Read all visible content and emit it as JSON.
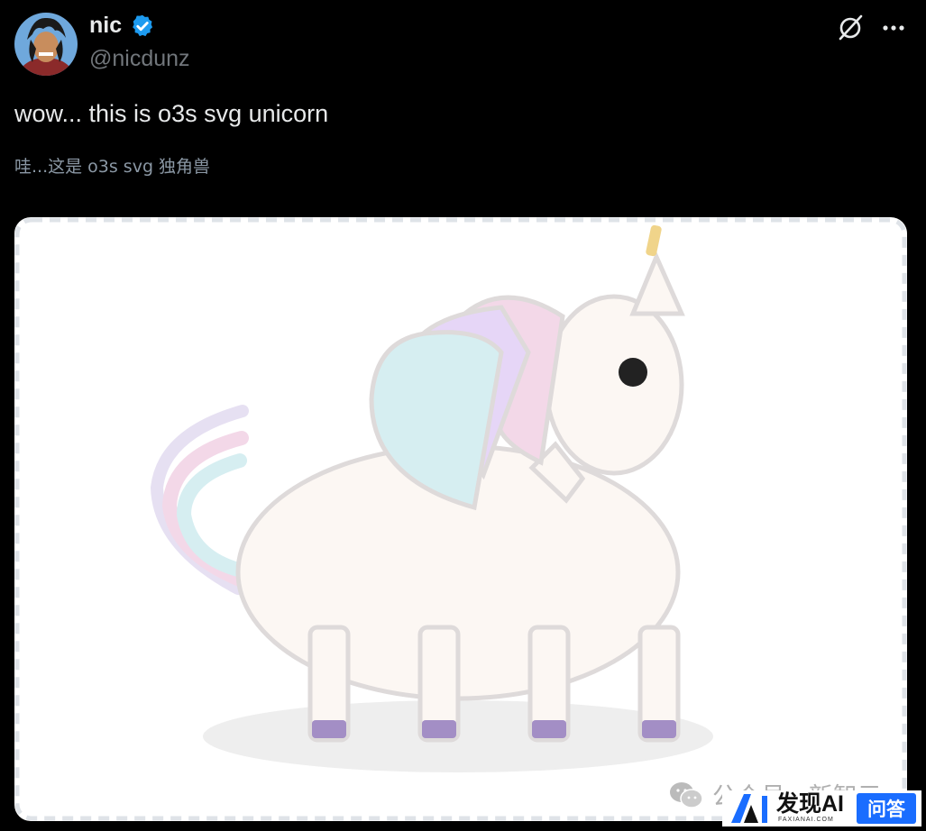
{
  "author": {
    "display_name": "nic",
    "handle": "@nicdunz",
    "verified": true,
    "avatar_icon": "anime-avatar-icon"
  },
  "actions": {
    "grok_icon": "grok-icon",
    "more_icon": "more-icon"
  },
  "tweet": {
    "text": "wow... this is o3s svg unicorn",
    "translation": "哇...这是 o3s svg 独角兽"
  },
  "media": {
    "description_icon": "unicorn-svg-image"
  },
  "watermarks": {
    "wechat_text": "公众号 · 新智元",
    "badge_title": "发现AI",
    "badge_sub": "FAXIANAI.COM",
    "badge_qa": "问答"
  },
  "colors": {
    "background": "#000000",
    "text_primary": "#e7e9ea",
    "text_secondary": "#71767b",
    "verified_blue": "#1d9bf0",
    "accent_blue": "#1a6dff"
  }
}
